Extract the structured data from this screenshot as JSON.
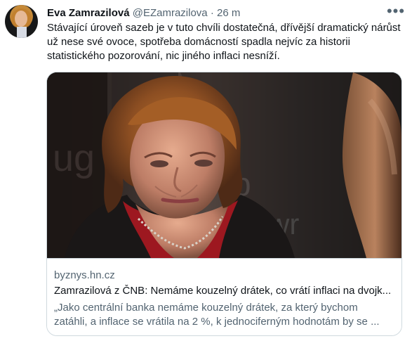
{
  "author": {
    "name": "Eva Zamrazilová",
    "handle": "@EZamrazilova",
    "separator": "·",
    "time": "26 m"
  },
  "tweet_text": "Stávající úroveň sazeb je v tuto chvíli dostatečná, dřívější dramatický nárůst\nuž nese své ovoce, spotřeba domácností spadla nejvíc za historii\nstatistického pozorování, nic jiného inflaci nesníží.",
  "link_card": {
    "domain": "byznys.hn.cz",
    "title": "Zamrazilová z ČNB: Nemáme kouzelný drátek, co vrátí inflaci na dvojk...",
    "description": "„Jako centrální banka nemáme kouzelný drátek, za který bychom\nzatáhli, a inflace se vrátila na 2 %, k jednociferným hodnotám by se ..."
  },
  "icons": {
    "more": "more-horizontal-icon"
  }
}
